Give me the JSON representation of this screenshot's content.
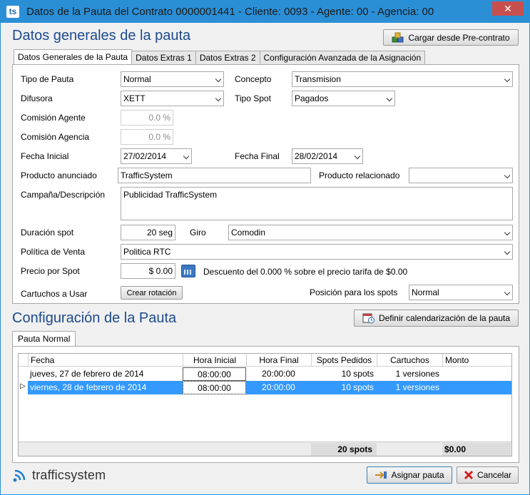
{
  "window": {
    "app_icon": "ts",
    "title": "Datos de la Pauta del Contrato 0000001441 - Cliente: 0093 - Agente: 00 - Agencia: 00",
    "close_label": "✕"
  },
  "general": {
    "title": "Datos generales de la pauta",
    "load_button": "Cargar desde Pre-contrato",
    "tabs": [
      {
        "label": "Datos Generales de la Pauta",
        "active": true
      },
      {
        "label": "Datos Extras 1",
        "active": false
      },
      {
        "label": "Datos Extras 2",
        "active": false
      },
      {
        "label": "Configuración Avanzada de la Asignación",
        "active": false
      }
    ]
  },
  "form": {
    "tipo_pauta": {
      "label": "Tipo de Pauta",
      "value": "Normal"
    },
    "concepto": {
      "label": "Concepto",
      "value": "Transmision"
    },
    "difusora": {
      "label": "Difusora",
      "value": "XETT"
    },
    "tipo_spot": {
      "label": "Tipo Spot",
      "value": "Pagados"
    },
    "comision_agente": {
      "label": "Comisión Agente",
      "value": "0.0 %"
    },
    "comision_agencia": {
      "label": "Comisión Agencia",
      "value": "0.0 %"
    },
    "fecha_inicial": {
      "label": "Fecha Inicial",
      "value": "27/02/2014"
    },
    "fecha_final": {
      "label": "Fecha Final",
      "value": "28/02/2014"
    },
    "producto_anunciado": {
      "label": "Producto anunciado",
      "value": "TrafficSystem"
    },
    "producto_relacionado": {
      "label": "Producto relacionado",
      "value": ""
    },
    "campana": {
      "label": "Campaña/Descripción",
      "value": "Publicidad TrafficSystem"
    },
    "duracion": {
      "label": "Duración spot",
      "value": "20 seg"
    },
    "giro": {
      "label": "Giro",
      "value": "Comodin"
    },
    "politica": {
      "label": "Política de Venta",
      "value": "Politica RTC"
    },
    "precio": {
      "label": "Precio por Spot",
      "value": "$ 0.00"
    },
    "descuento_text": "Descuento del 0.000 % sobre el precio tarifa de $0.00",
    "cartuchos": {
      "label": "Cartuchos a Usar",
      "button": "Crear rotación"
    },
    "posicion": {
      "label": "Posición para los spots",
      "value": "Normal"
    }
  },
  "config": {
    "title": "Configuración de la Pauta",
    "define_button": "Definir calendarización de la pauta",
    "tab": "Pauta Normal",
    "columns": [
      "Fecha",
      "Hora Inicial",
      "Hora Final",
      "Spots Pedidos",
      "Cartuchos",
      "Monto"
    ],
    "rows": [
      {
        "fecha": "jueves, 27 de febrero de 2014",
        "hora_inicial": "08:00:00",
        "hora_final": "20:00:00",
        "spots": "10 spots",
        "cartuchos": "1 versiones",
        "monto": "",
        "selected": false
      },
      {
        "fecha": "viernes, 28 de febrero de 2014",
        "hora_inicial": "08:00:00",
        "hora_final": "20:00:00",
        "spots": "10 spots",
        "cartuchos": "1 versiones",
        "monto": "",
        "selected": true
      }
    ],
    "total_spots": "20 spots",
    "total_monto": "$0.00"
  },
  "footer": {
    "logo_text": "trafficsystem",
    "assign_button": "Asignar pauta",
    "cancel_button": "Cancelar"
  },
  "colors": {
    "titlebar": "#2b8fd6",
    "section_title": "#1d4a8f",
    "selection": "#3399ff",
    "close": "#c7504f"
  }
}
